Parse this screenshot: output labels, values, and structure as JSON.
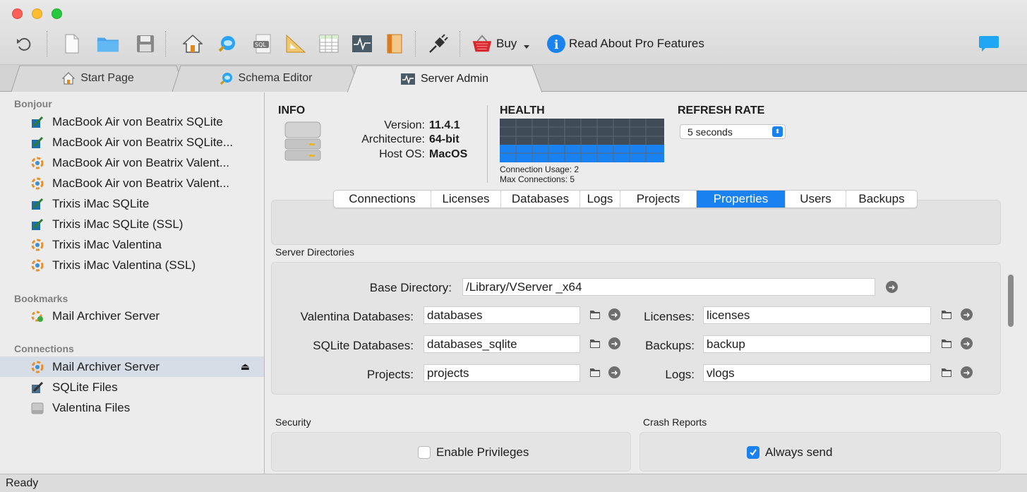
{
  "toolbar": {
    "buy_label": "Buy",
    "pro_label": "Read About Pro Features",
    "icons": [
      "undo-icon",
      "new-file-icon",
      "folder-icon",
      "save-icon",
      "home-icon",
      "schema-icon",
      "sql-icon",
      "diagram-icon",
      "table-icon",
      "server-admin-icon",
      "book-icon",
      "plug-icon",
      "basket-icon",
      "info-icon",
      "chat-icon"
    ]
  },
  "tabs": [
    {
      "label": "Start Page"
    },
    {
      "label": "Schema Editor"
    },
    {
      "label": "Server Admin",
      "active": true
    }
  ],
  "sidebar": {
    "sections": {
      "bonjour": "Bonjour",
      "bookmarks": "Bookmarks",
      "connections": "Connections"
    },
    "bonjour_items": [
      {
        "label": "MacBook Air von Beatrix SQLite",
        "icon": "sqlite-icon"
      },
      {
        "label": "MacBook Air von Beatrix SQLite...",
        "icon": "sqlite-icon"
      },
      {
        "label": "MacBook Air von Beatrix Valent...",
        "icon": "valentina-icon"
      },
      {
        "label": "MacBook Air von Beatrix Valent...",
        "icon": "valentina-icon"
      },
      {
        "label": "Trixis iMac SQLite",
        "icon": "sqlite-icon"
      },
      {
        "label": "Trixis iMac SQLite (SSL)",
        "icon": "sqlite-icon"
      },
      {
        "label": "Trixis iMac Valentina",
        "icon": "valentina-icon"
      },
      {
        "label": "Trixis iMac Valentina (SSL)",
        "icon": "valentina-icon"
      }
    ],
    "bookmark_items": [
      {
        "label": "Mail Archiver Server",
        "icon": "bookmark-server-icon"
      }
    ],
    "connection_items": [
      {
        "label": "Mail Archiver Server",
        "icon": "valentina-icon",
        "selected": true
      },
      {
        "label": "SQLite Files",
        "icon": "sqlite-files-icon"
      },
      {
        "label": "Valentina Files",
        "icon": "valentina-files-icon"
      }
    ]
  },
  "info": {
    "heading": "INFO",
    "version_label": "Version:",
    "version_value": "11.4.1",
    "arch_label": "Architecture:",
    "arch_value": "64-bit",
    "os_label": "Host OS:",
    "os_value": "MacOS"
  },
  "health": {
    "heading": "HEALTH",
    "usage": "Connection Usage: 2",
    "max": "Max Connections: 5"
  },
  "refresh": {
    "heading": "REFRESH RATE",
    "value": "5 seconds"
  },
  "subtabs": [
    "Connections",
    "Licenses",
    "Databases",
    "Logs",
    "Projects",
    "Properties",
    "Users",
    "Backups"
  ],
  "active_subtab": "Properties",
  "server_dirs": {
    "heading": "Server Directories",
    "base_label": "Base Directory:",
    "base_value": "/Library/VServer _x64",
    "valentina_label": "Valentina Databases:",
    "valentina_value": "databases",
    "sqlite_label": "SQLite Databases:",
    "sqlite_value": "databases_sqlite",
    "projects_label": "Projects:",
    "projects_value": "projects",
    "licenses_label": "Licenses:",
    "licenses_value": "licenses",
    "backups_label": "Backups:",
    "backups_value": "backup",
    "logs_label": "Logs:",
    "logs_value": "vlogs"
  },
  "security": {
    "heading": "Security",
    "privileges_label": "Enable Privileges",
    "privileges_checked": false
  },
  "crash": {
    "heading": "Crash Reports",
    "always_label": "Always send",
    "always_checked": true
  },
  "status": "Ready",
  "colors": {
    "accent": "#1a82f0",
    "health_bar": "#1a82f0"
  }
}
